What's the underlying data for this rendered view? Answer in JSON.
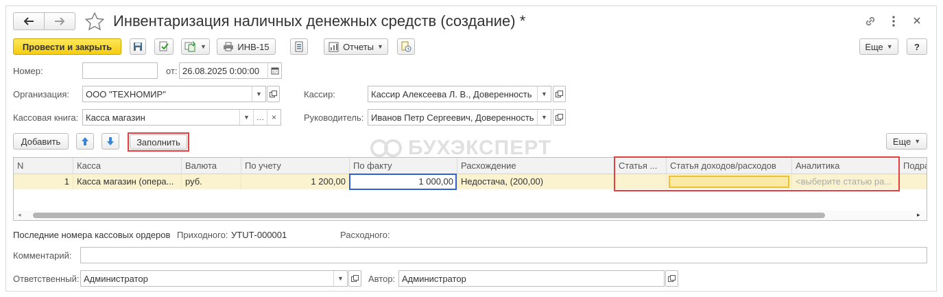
{
  "window": {
    "title": "Инвентаризация наличных денежных средств (создание) *"
  },
  "toolbar": {
    "post_close": "Провести и закрыть",
    "inv15": "ИНВ-15",
    "reports": "Отчеты",
    "more": "Еще",
    "help": "?"
  },
  "form": {
    "number_label": "Номер:",
    "number_value": "",
    "from_label": "от:",
    "date_value": "26.08.2025  0:00:00",
    "org_label": "Организация:",
    "org_value": "ООО \"ТЕХНОМИР\"",
    "cashier_label": "Кассир:",
    "cashier_value": "Кассир Алексеева Л. В., Доверенность",
    "cashbook_label": "Кассовая книга:",
    "cashbook_value": "Касса магазин",
    "head_label": "Руководитель:",
    "head_value": "Иванов Петр Сергеевич, Доверенность"
  },
  "table_toolbar": {
    "add": "Добавить",
    "fill": "Заполнить",
    "more": "Еще"
  },
  "watermark": "БУХЭКСПЕРТ",
  "table": {
    "columns": [
      "N",
      "Касса",
      "Валюта",
      "По учету",
      "По факту",
      "Расхождение",
      "Статья ...",
      "Статья доходов/расходов",
      "Аналитика",
      "Подра"
    ],
    "rows": [
      {
        "n": "1",
        "cash": "Касса магазин (опера...",
        "currency": "руб.",
        "by_account": "1 200,00",
        "by_fact": "1 000,00",
        "diff": "Недостача, (200,00)",
        "article": "",
        "income_article": "",
        "analytics": "<выберите статью ра..."
      }
    ]
  },
  "footer": {
    "last_numbers": "Последние номера кассовых ордеров",
    "incoming_label": "Приходного:",
    "incoming_value": "УТUТ-000001",
    "outgoing_label": "Расходного:",
    "outgoing_value": "",
    "comment_label": "Комментарий:",
    "comment_value": "",
    "responsible_label": "Ответственный:",
    "responsible_value": "Администратор",
    "author_label": "Автор:",
    "author_value": "Администратор"
  }
}
